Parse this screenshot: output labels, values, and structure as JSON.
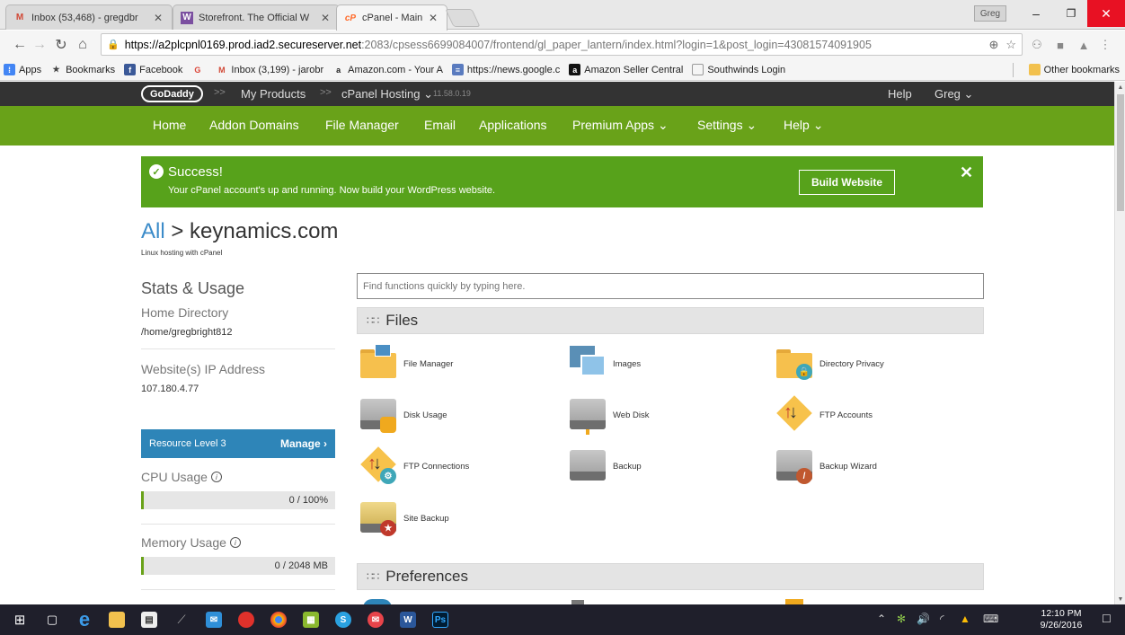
{
  "browser": {
    "tabs": [
      {
        "title": "Inbox (53,468) - gregdbr",
        "favicon": "M",
        "color": "#d14836"
      },
      {
        "title": "Storefront. The Official W",
        "favicon": "W",
        "color": "#7b4fa0"
      },
      {
        "title": "cPanel - Main",
        "favicon": "cP",
        "color": "#ff6c2c"
      }
    ],
    "profile": "Greg",
    "url_host": "https://a2plcpnl0169.prod.iad2.secureserver.net",
    "url_rest": ":2083/cpsess6699084007/frontend/gl_paper_lantern/index.html?login=1&post_login=43081574091905",
    "bookmarks": [
      {
        "label": "Apps",
        "icon": "apps-grid-icon",
        "color": "#4285f4"
      },
      {
        "label": "Bookmarks",
        "icon": "star-icon",
        "color": "#444"
      },
      {
        "label": "Facebook",
        "icon": "f",
        "color": "#3b5998"
      },
      {
        "label": "",
        "icon": "G",
        "color": "#db4437"
      },
      {
        "label": "Inbox (3,199) - jarobr",
        "icon": "M",
        "color": "#d14836"
      },
      {
        "label": "Amazon.com - Your A",
        "icon": "a",
        "color": "#222"
      },
      {
        "label": "https://news.google.c",
        "icon": "N",
        "color": "#5a7bbf"
      },
      {
        "label": "Amazon Seller Central",
        "icon": "a",
        "color": "#111"
      },
      {
        "label": "Southwinds Login",
        "icon": "doc",
        "color": "#888"
      }
    ],
    "other_bookmarks": "Other bookmarks"
  },
  "godaddy": {
    "logo": "GoDaddy",
    "my_products": "My Products",
    "cpanel_hosting": "cPanel Hosting",
    "version": "11.58.0.19",
    "help": "Help",
    "user": "Greg"
  },
  "nav": {
    "items": [
      "Home",
      "Addon Domains",
      "File Manager",
      "Email",
      "Applications",
      "Premium Apps",
      "Settings",
      "Help"
    ]
  },
  "success": {
    "title": "Success!",
    "message": "Your cPanel account's up and running. Now build your WordPress website.",
    "button": "Build Website"
  },
  "breadcrumb": {
    "all": "All",
    "sep": ">",
    "domain": "keynamics.com",
    "sub": "Linux hosting with cPanel"
  },
  "stats": {
    "title": "Stats & Usage",
    "home_dir_label": "Home Directory",
    "home_dir": "/home/gregbright812",
    "ip_label": "Website(s) IP Address",
    "ip": "107.180.4.77",
    "resource_level": "Resource Level 3",
    "manage": "Manage",
    "cpu_label": "CPU Usage",
    "cpu_value": "0 / 100%",
    "cpu_fraction": 0,
    "mem_label": "Memory Usage",
    "mem_value": "0 / 2048 MB",
    "mem_fraction": 0
  },
  "search": {
    "placeholder": "Find functions quickly by typing here."
  },
  "files": {
    "title": "Files",
    "items": [
      "File Manager",
      "Images",
      "Directory Privacy",
      "Disk Usage",
      "Web Disk",
      "FTP Accounts",
      "FTP Connections",
      "Backup",
      "Backup Wizard",
      "Site Backup"
    ]
  },
  "preferences": {
    "title": "Preferences"
  },
  "taskbar": {
    "time": "12:10 PM",
    "date": "9/26/2016"
  }
}
